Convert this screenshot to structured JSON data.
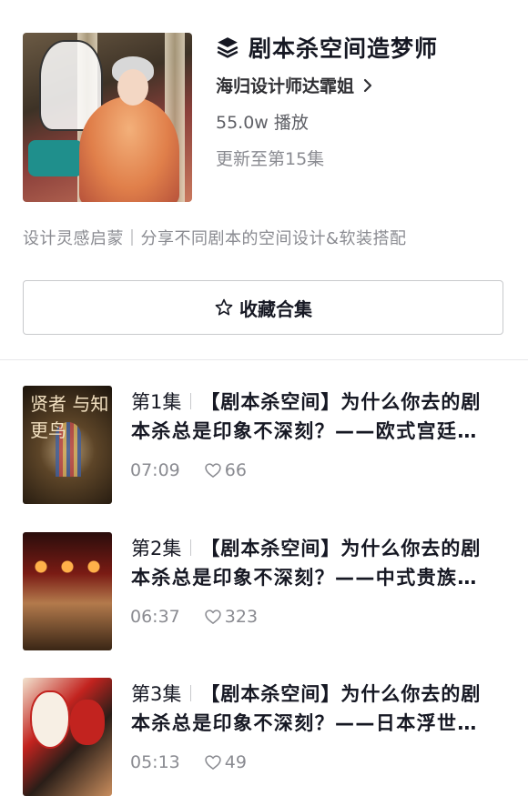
{
  "collection": {
    "title": "剧本杀空间造梦师",
    "author": "海归设计师达霏姐",
    "plays": "55.0w 播放",
    "update_status": "更新至第15集",
    "description": "设计灵感启蒙｜分享不同剧本的空间设计&软装搭配",
    "collect_label": "收藏合集"
  },
  "episodes": [
    {
      "number": "第1集",
      "title_line1": "【剧本杀空间】为什么你去的剧",
      "title_line2": "本杀总是印象不深刻？——欧式宫廷…",
      "duration": "07:09",
      "likes": "66",
      "thumb_text": "贤者 与知更鸟"
    },
    {
      "number": "第2集",
      "title_line1": "【剧本杀空间】为什么你去的剧",
      "title_line2": "本杀总是印象不深刻？——中式贵族…",
      "duration": "06:37",
      "likes": "323"
    },
    {
      "number": "第3集",
      "title_line1": "【剧本杀空间】为什么你去的剧",
      "title_line2": "本杀总是印象不深刻？——日本浮世…",
      "duration": "05:13",
      "likes": "49"
    }
  ],
  "icons": {
    "collection": "layers-icon",
    "author_link": "chevron-right-icon",
    "collect": "star-outline-icon",
    "likes": "heart-outline-icon"
  },
  "colors": {
    "text_primary": "#161823",
    "text_secondary": "#8a8b91",
    "border": "#c8c9cc"
  }
}
